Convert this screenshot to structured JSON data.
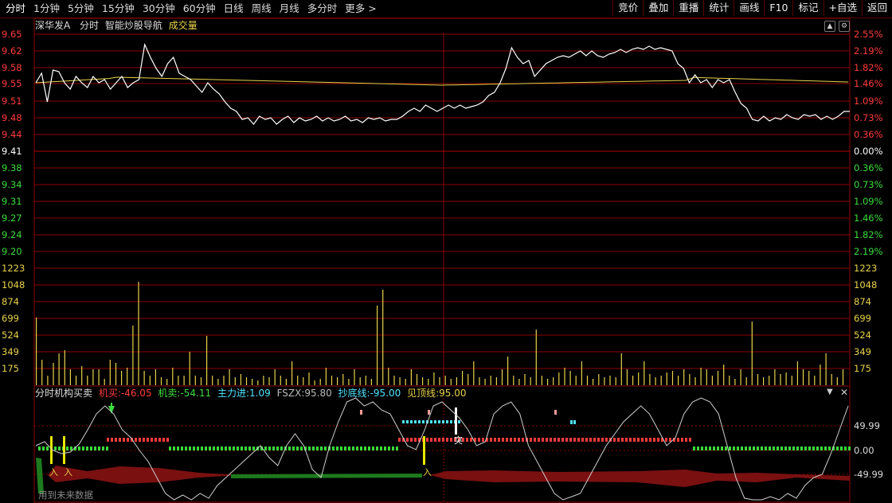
{
  "toolbar": {
    "tabs": [
      "分时",
      "1分钟",
      "5分钟",
      "15分钟",
      "30分钟",
      "60分钟",
      "日线",
      "周线",
      "月线",
      "多分时",
      "更多"
    ],
    "more_arrow": ">",
    "right_buttons": [
      "竞价",
      "叠加",
      "重播",
      "统计",
      "画线",
      "F10",
      "标记",
      "+自选",
      "返回"
    ]
  },
  "header": {
    "stock_name": "深华发A",
    "mode": "分时",
    "nav": "智能炒股导航",
    "volume_label": "成交量"
  },
  "price_axis": {
    "left": [
      "9.65",
      "9.62",
      "9.58",
      "9.55",
      "9.51",
      "9.48",
      "9.44",
      "9.41",
      "9.38",
      "9.34",
      "9.31",
      "9.27",
      "9.24",
      "9.20"
    ],
    "right": [
      "2.55%",
      "2.19%",
      "1.82%",
      "1.46%",
      "1.09%",
      "0.73%",
      "0.36%",
      "0.00%",
      "0.36%",
      "0.73%",
      "1.09%",
      "1.46%",
      "1.82%",
      "2.19%"
    ]
  },
  "volume_axis": {
    "left": [
      "1223",
      "1048",
      "874",
      "699",
      "524",
      "349",
      "175"
    ],
    "right": [
      "1223",
      "1048",
      "874",
      "699",
      "524",
      "349",
      "175"
    ]
  },
  "indicator": {
    "title": "分时机构买卖",
    "jimai_label": "机买:",
    "jimai_value": "-46.05",
    "jimai2_label": "机卖:",
    "jimai2_value": "-54.11",
    "zhuli_label": "主力进:",
    "zhuli_value": "1.09",
    "fszx_label": "FSZX:",
    "fszx_value": "95.80",
    "chaodi_label": "抄底线:",
    "chaodi_value": "-95.00",
    "jianding_label": "见顶线:",
    "jianding_value": "95.00",
    "axis_right": [
      "49.99",
      "0.00",
      "-49.99"
    ],
    "note": "用到未来数据",
    "marker_ru": "入",
    "marker_tu": "突"
  },
  "colors": {
    "up": "#ff3b3b",
    "down": "#3bdc3b",
    "neutral": "#ffffff",
    "grid": "#8b0000",
    "price_line": "#ffffff",
    "avg_line": "#e8d24a",
    "volume": "#e8d24a",
    "cyan": "#4fe3ff"
  },
  "icons": [
    "up-arrow-icon",
    "settings-icon",
    "dropdown-icon",
    "close-icon"
  ]
}
